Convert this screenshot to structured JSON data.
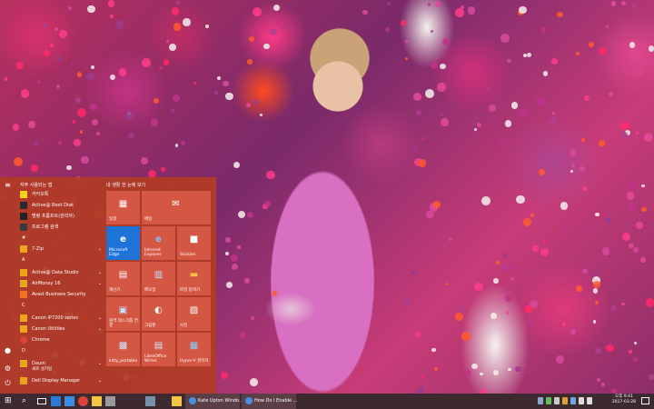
{
  "start_menu": {
    "most_used_title": "자주 사용되는 앱",
    "most_used": [
      {
        "label": "카카오톡",
        "color": "#f7d11e"
      },
      {
        "label": "Active@ Boot Disk",
        "color": "#2b2b2b"
      },
      {
        "label": "명령 프롬프트(관리자)",
        "color": "#222"
      },
      {
        "label": "프로그램 검색",
        "color": "#3a3a3a"
      }
    ],
    "sections": [
      {
        "letter": "#",
        "apps": [
          {
            "label": "7-Zip",
            "color": "#e8a41a",
            "expand": true
          }
        ]
      },
      {
        "letter": "A",
        "apps": [
          {
            "label": "Active@ Data Studio",
            "color": "#e8a41a",
            "expand": true
          },
          {
            "label": "AirMoney 16",
            "color": "#e8a41a",
            "expand": true
          },
          {
            "label": "Avast Business Security",
            "color": "#f36f21",
            "expand": false
          }
        ]
      },
      {
        "letter": "C",
        "apps": [
          {
            "label": "Canon iP7200 series",
            "color": "#e8a41a",
            "expand": true
          },
          {
            "label": "Canon Utilities",
            "color": "#e8a41a",
            "expand": true
          },
          {
            "label": "Chrome",
            "color": "#db4437",
            "expand": false
          }
        ]
      },
      {
        "letter": "D",
        "apps": [
          {
            "label": "Daum",
            "color": "#e8a41a",
            "expand": true
          },
          {
            "label": "새로 설치됨",
            "color": "#e8a41a",
            "expand": false
          },
          {
            "label": "Dell Display Manager",
            "color": "#e8a41a",
            "expand": true
          }
        ]
      }
    ],
    "rail_icons": [
      "hamburger-icon",
      "user-icon",
      "settings-icon",
      "power-icon"
    ],
    "tiles_title": "내 생활 한 눈에 보기",
    "tiles": [
      {
        "label": "일정",
        "icon": "▦",
        "icon_name": "calendar-icon",
        "bg": "#d6584a"
      },
      {
        "label": "메일",
        "icon": "✉",
        "icon_name": "mail-icon",
        "bg": "#d6584a"
      },
      {
        "label": "Microsoft Edge",
        "icon": "e",
        "icon_name": "edge-icon",
        "bg": "#1e73d8"
      },
      {
        "label": "Internet Explorer",
        "icon": "e",
        "icon_name": "ie-icon",
        "bg": "#d6584a"
      },
      {
        "label": "Stickies",
        "icon": "■",
        "icon_name": "stickies-icon",
        "bg": "#d6584a"
      },
      {
        "label": "계산기",
        "icon": "▤",
        "icon_name": "calculator-icon",
        "bg": "#d6584a"
      },
      {
        "label": "메모장",
        "icon": "▥",
        "icon_name": "notepad-icon",
        "bg": "#d6584a"
      },
      {
        "label": "파일 탐색기",
        "icon": "▬",
        "icon_name": "folder-icon",
        "bg": "#d6584a"
      },
      {
        "label": "원격 데스크톱 연결",
        "icon": "▣",
        "icon_name": "remote-desktop-icon",
        "bg": "#d6584a"
      },
      {
        "label": "그림판",
        "icon": "◐",
        "icon_name": "paint-icon",
        "bg": "#d6584a"
      },
      {
        "label": "사진",
        "icon": "▨",
        "icon_name": "photos-icon",
        "bg": "#d6584a"
      },
      {
        "label": "kitty_portable",
        "icon": "▩",
        "icon_name": "kitty-icon",
        "bg": "#d6584a"
      },
      {
        "label": "LibreOffice Writer",
        "icon": "▤",
        "icon_name": "writer-icon",
        "bg": "#d6584a"
      },
      {
        "label": "Hyper-V 관리자",
        "icon": "▦",
        "icon_name": "hyperv-icon",
        "bg": "#d6584a"
      }
    ]
  },
  "taskbar": {
    "windows": [
      {
        "label": "Kate Upton Windo...",
        "color": "#4a8fe0"
      },
      {
        "label": "How Do I Enable ...",
        "color": "#4a8fe0"
      }
    ],
    "clock": {
      "time": "오후 9:41",
      "date": "2017-03-28"
    }
  }
}
